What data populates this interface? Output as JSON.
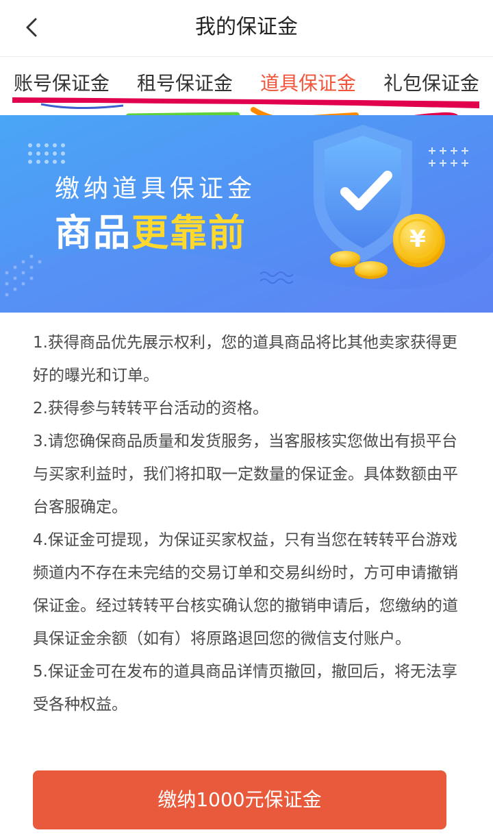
{
  "header": {
    "title": "我的保证金",
    "back_icon": "chevron-left-icon"
  },
  "tabs": [
    {
      "label": "账号保证金",
      "active": false
    },
    {
      "label": "租号保证金",
      "active": false
    },
    {
      "label": "道具保证金",
      "active": true
    },
    {
      "label": "礼包保证金",
      "active": false
    }
  ],
  "banner": {
    "line1": "缴纳道具保证金",
    "line2_white": "商品",
    "line2_yellow": "更靠前",
    "shield_icon": "shield-check-icon",
    "coin_icon": "yen-coin-icon"
  },
  "rules": [
    "1.获得商品优先展示权利，您的道具商品将比其他卖家获得更好的曝光和订单。",
    "2.获得参与转转平台活动的资格。",
    "3.请您确保商品质量和发货服务，当客服核实您做出有损平台与买家利益时，我们将扣取一定数量的保证金。具体数额由平台客服确定。",
    "4.保证金可提现，为保证买家权益，只有当您在转转平台游戏频道内不存在未完结的交易订单和交易纠纷时，方可申请撤销保证金。经过转转平台核实确认您的撤销申请后，您缴纳的道具保证金余额（如有）将原路退回您的微信支付账户。",
    "5.保证金可在发布的道具商品详情页撤回，撤回后，将无法享受各种权益。"
  ],
  "pay_button": {
    "label": "缴纳1000元保证金"
  },
  "colors": {
    "accent": "#f2553b",
    "button": "#e85a3b",
    "banner_start": "#4aa6f6",
    "banner_end": "#5b7ef2",
    "headline_yellow": "#ffd92e",
    "annotation_red": "#e0004d",
    "annotation_green": "#5ed13a",
    "annotation_orange": "#ff8a00"
  }
}
